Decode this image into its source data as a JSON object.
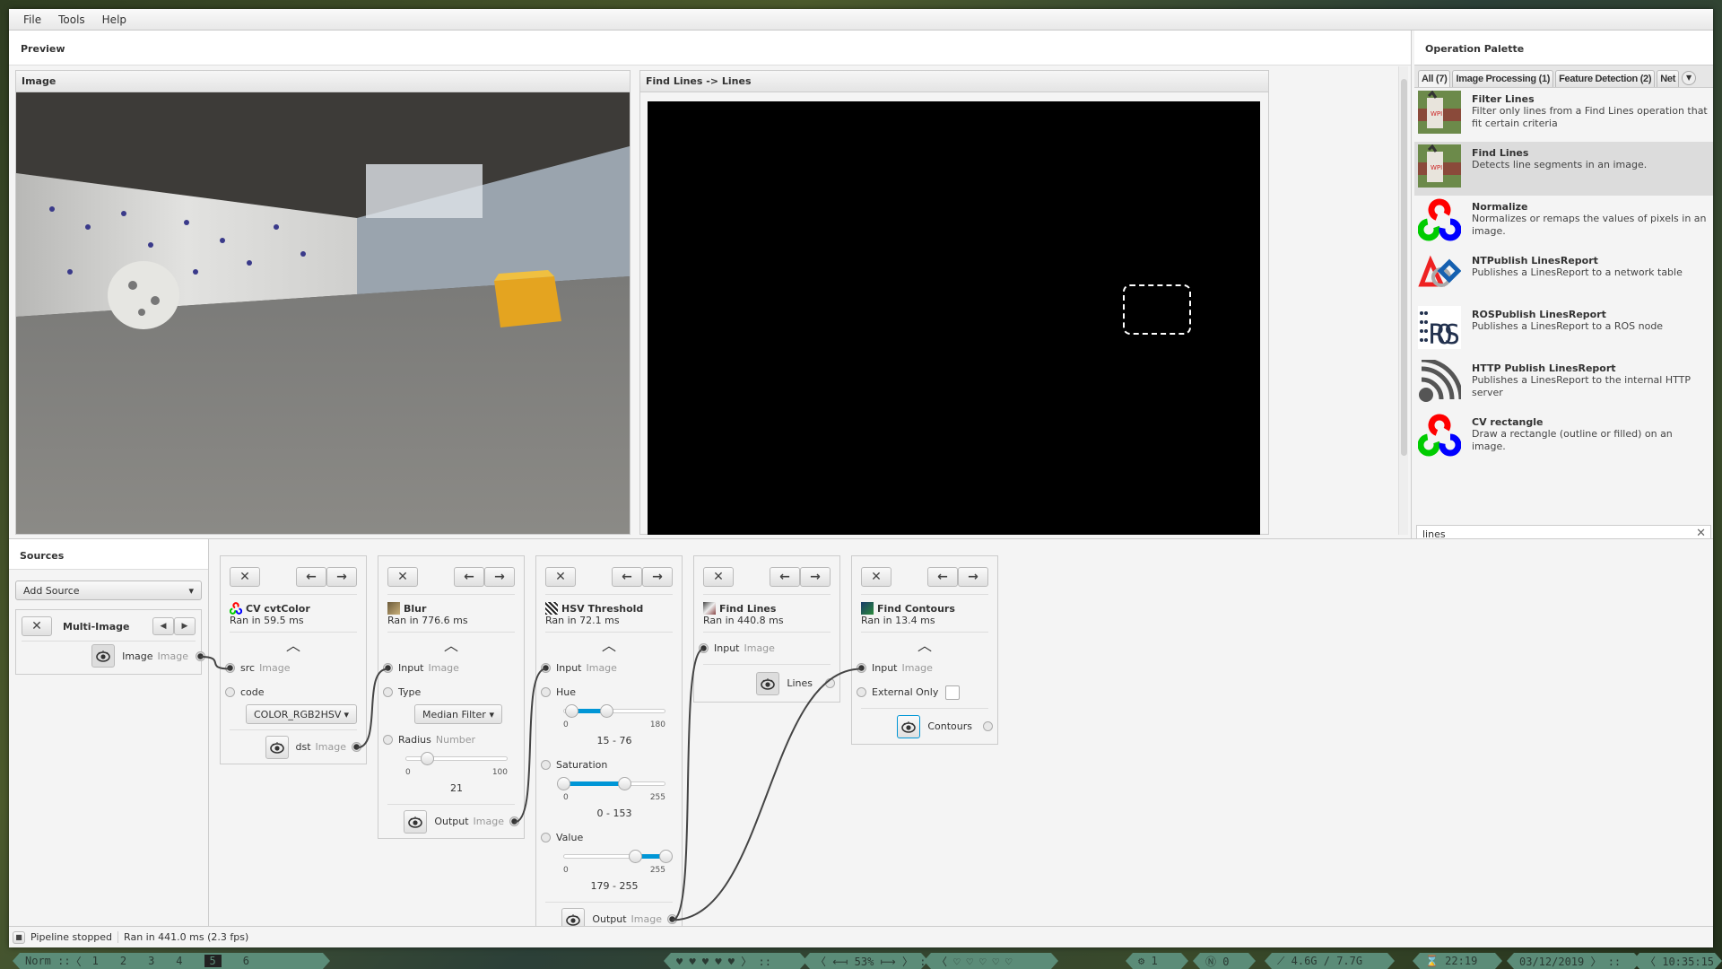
{
  "menu": [
    "File",
    "Tools",
    "Help"
  ],
  "preview": {
    "title": "Preview",
    "panels": [
      {
        "title": "Image"
      },
      {
        "title": "Find Lines -> Lines"
      }
    ]
  },
  "palette": {
    "title": "Operation Palette",
    "tabs": [
      "All (7)",
      "Image Processing (1)",
      "Feature Detection (2)",
      "Net"
    ],
    "search": "lines",
    "items": [
      {
        "name": "Filter Lines",
        "desc": "Filter only lines from a Find Lines operation that fit certain criteria",
        "icon": "goat-lines-icon"
      },
      {
        "name": "Find Lines",
        "desc": "Detects line segments in an image.",
        "icon": "goat-lines-icon",
        "selected": true
      },
      {
        "name": "Normalize",
        "desc": "Normalizes or remaps the values of pixels in an image.",
        "icon": "opencv-icon"
      },
      {
        "name": "NTPublish LinesReport",
        "desc": "Publishes a LinesReport to a network table",
        "icon": "first-logo-icon"
      },
      {
        "name": "ROSPublish LinesReport",
        "desc": "Publishes a LinesReport to a ROS node",
        "icon": "ros-icon"
      },
      {
        "name": "HTTP Publish LinesReport",
        "desc": "Publishes a LinesReport to the internal HTTP server",
        "icon": "rss-icon"
      },
      {
        "name": "CV rectangle",
        "desc": "Draw a rectangle (outline or filled) on an image.",
        "icon": "opencv-icon"
      }
    ]
  },
  "sources": {
    "title": "Sources",
    "add_source": "Add Source",
    "source": {
      "name": "Multi-Image",
      "output": "Image",
      "output_type": "Image"
    }
  },
  "steps": {
    "cvt": {
      "name": "CV cvtColor",
      "ran": "Ran in 59.5 ms",
      "in_label": "src",
      "in_type": "Image",
      "code_label": "code",
      "code_value": "COLOR_RGB2HSV",
      "out_label": "dst",
      "out_type": "Image"
    },
    "blur": {
      "name": "Blur",
      "ran": "Ran in 776.6 ms",
      "in_label": "Input",
      "in_type": "Image",
      "type_label": "Type",
      "type_value": "Median Filter",
      "radius_label": "Radius",
      "radius_type": "Number",
      "radius_min": "0",
      "radius_max": "100",
      "radius_value": "21",
      "out_label": "Output",
      "out_type": "Image"
    },
    "hsv": {
      "name": "HSV Threshold",
      "ran": "Ran in 72.1 ms",
      "in_label": "Input",
      "in_type": "Image",
      "hue_label": "Hue",
      "hue_min": "0",
      "hue_max": "180",
      "hue_range": "15 - 76",
      "sat_label": "Saturation",
      "sat_min": "0",
      "sat_max": "255",
      "sat_range": "0 - 153",
      "val_label": "Value",
      "val_min": "0",
      "val_max": "255",
      "val_range": "179 - 255",
      "out_label": "Output",
      "out_type": "Image"
    },
    "lines": {
      "name": "Find Lines",
      "ran": "Ran in 440.8 ms",
      "in_label": "Input",
      "in_type": "Image",
      "out_label": "Lines"
    },
    "contours": {
      "name": "Find Contours",
      "ran": "Ran in 13.4 ms",
      "in_label": "Input",
      "in_type": "Image",
      "ext_label": "External Only",
      "out_label": "Contours"
    }
  },
  "sliders": {
    "radius": {
      "min": 0,
      "max": 100,
      "lo": 21
    },
    "hue": {
      "min": 0,
      "max": 180,
      "lo": 15,
      "hi": 76
    },
    "sat": {
      "min": 0,
      "max": 255,
      "lo": 0,
      "hi": 153
    },
    "val": {
      "min": 0,
      "max": 255,
      "lo": 179,
      "hi": 255
    }
  },
  "status": {
    "state": "Pipeline stopped",
    "ran": "Ran in 441.0 ms (2.3 fps)"
  },
  "taskbar": {
    "mode": "Norm ::",
    "workspaces": [
      "1",
      "2",
      "3",
      "4",
      "5",
      "6"
    ],
    "current": "5",
    "hearts_full": "♥ ♥ ♥ ♥ ♥ 〉 ::",
    "volume": "〈 ⟻ 53% ⟼ 〉 ::",
    "hearts_empty": "〈 ♡ ♡ ♡ ♡ ♡",
    "cpu": "⚙ 1",
    "net": "Ⓝ 0",
    "mem": "⟋ 4.6G / 7.7G",
    "timer": "⌛ 22:19",
    "date": "03/12/2019 〉 ::",
    "time": "〈 10:35:15"
  },
  "colors": {
    "accent": "#0096d6",
    "taskbar": "#5b8c78"
  }
}
